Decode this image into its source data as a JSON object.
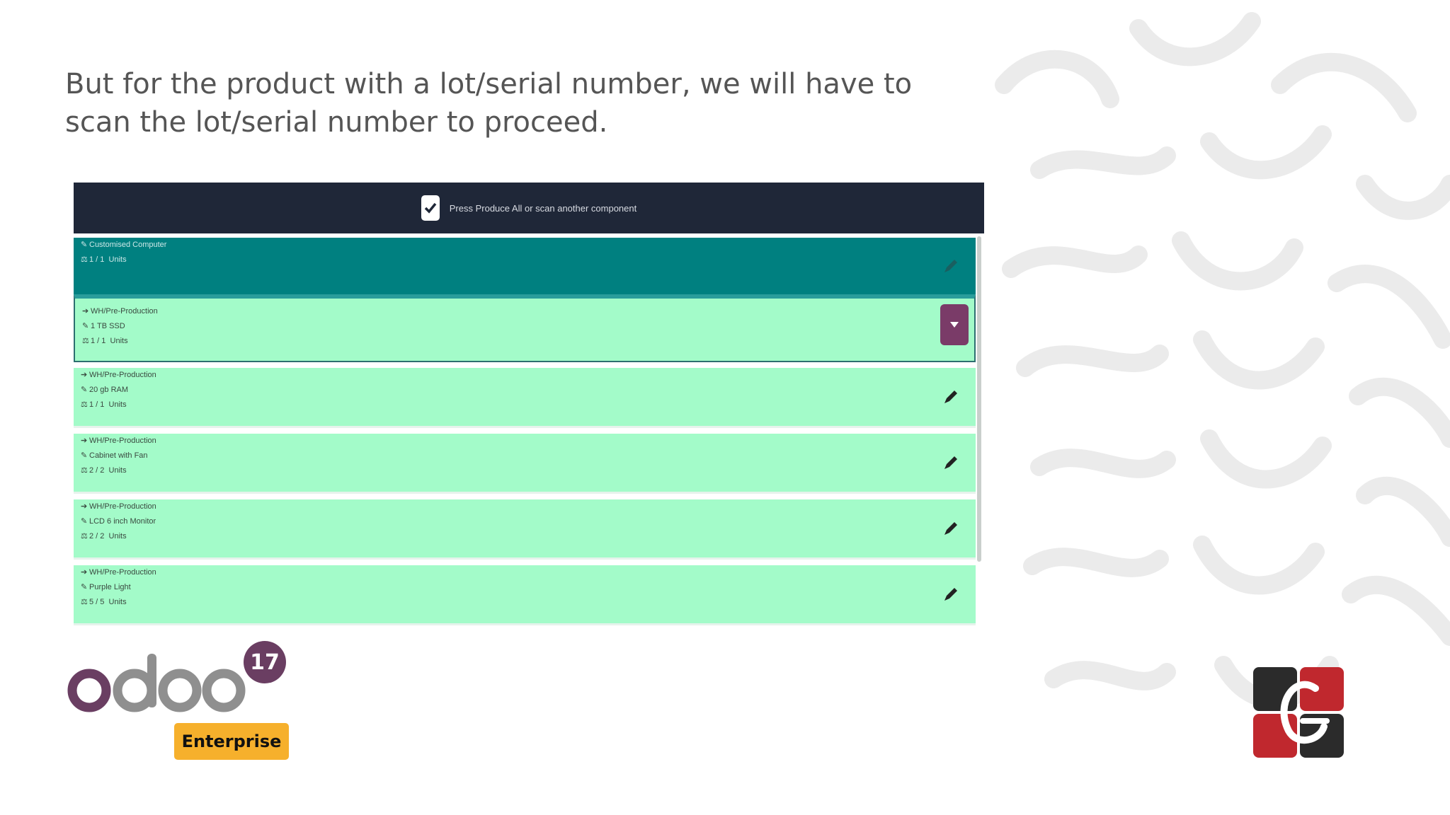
{
  "caption": "But for the product with a lot/serial number, we will have to scan the lot/serial number to proceed.",
  "screenshot": {
    "topbar_text": "Press Produce All or scan another component",
    "header_row": {
      "product": "Customised Computer",
      "qty": "1 / 1",
      "uom": "Units"
    },
    "rows": [
      {
        "location": "WH/Pre-Production",
        "product": "1 TB SSD",
        "qty": "1 / 1",
        "uom": "Units"
      },
      {
        "location": "WH/Pre-Production",
        "product": "20 gb RAM",
        "qty": "1 / 1",
        "uom": "Units"
      },
      {
        "location": "WH/Pre-Production",
        "product": "Cabinet with Fan",
        "qty": "2 / 2",
        "uom": "Units"
      },
      {
        "location": "WH/Pre-Production",
        "product": "LCD 6 inch Monitor",
        "qty": "2 / 2",
        "uom": "Units"
      },
      {
        "location": "WH/Pre-Production",
        "product": "Purple Light",
        "qty": "5 / 5",
        "uom": "Units"
      }
    ]
  },
  "logo": {
    "brand": "odoo",
    "version": "17",
    "edition": "Enterprise"
  },
  "colors": {
    "topbar": "#1f2738",
    "header_row": "#008080",
    "row": "#a3fbc9",
    "accent_purple": "#7a3b68",
    "edition_badge": "#f6b02c"
  }
}
